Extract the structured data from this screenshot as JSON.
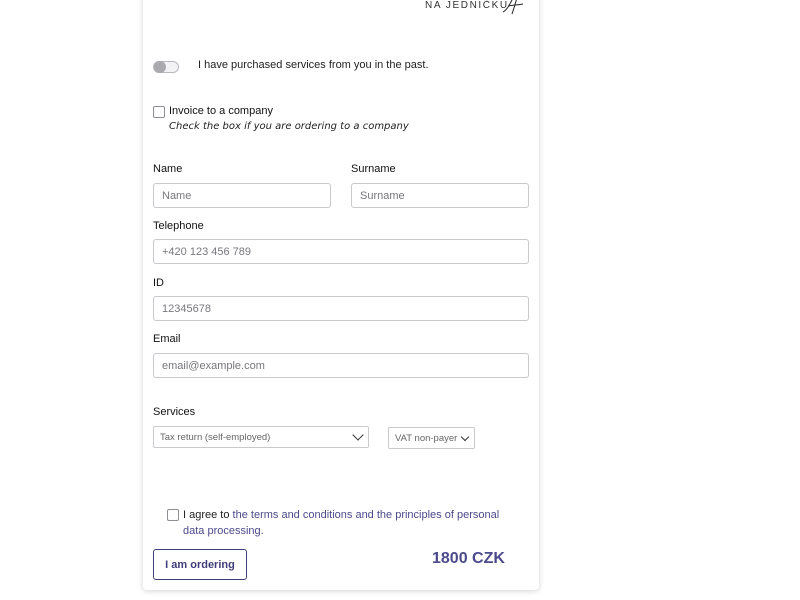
{
  "brand": {
    "name": "NA JEDNIČKU"
  },
  "returning": {
    "label": "I have purchased services from you in the past."
  },
  "company": {
    "label": "Invoice to a company",
    "hint": "Check the box if you are ordering to a company"
  },
  "form": {
    "name_label": "Name",
    "name_placeholder": "Name",
    "surname_label": "Surname",
    "surname_placeholder": "Surname",
    "telephone_label": "Telephone",
    "telephone_placeholder": "+420 123 456 789",
    "id_label": "ID",
    "id_placeholder": "12345678",
    "email_label": "Email",
    "email_placeholder": "email@example.com"
  },
  "services": {
    "label": "Services",
    "service_selected": "Tax return (self-employed)",
    "vat_selected": "VAT non-payer"
  },
  "terms": {
    "prefix": "I agree to ",
    "link_text": "the terms and conditions and the principles of personal data processing."
  },
  "order": {
    "button_label": "I am ordering",
    "price": "1800 CZK"
  },
  "colors": {
    "accent": "#4b4a8c",
    "button_border": "#3f3e7a"
  }
}
